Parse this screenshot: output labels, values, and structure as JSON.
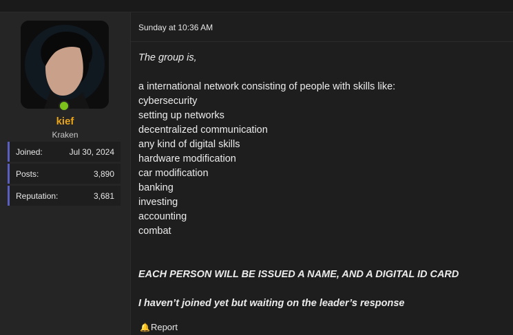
{
  "user": {
    "name": "kief",
    "title": "Kraken",
    "online": true,
    "stats": [
      {
        "label": "Joined:",
        "value": "Jul 30, 2024"
      },
      {
        "label": "Posts:",
        "value": "3,890"
      },
      {
        "label": "Reputation:",
        "value": "3,681"
      }
    ]
  },
  "post": {
    "timestamp": "Sunday at 10:36 AM",
    "intro": "The group is,",
    "lead": "a international network consisting of people with skills like:",
    "skills": [
      "cybersecurity",
      "setting up networks",
      "decentralized communication",
      "any kind of digital skills",
      "hardware modification",
      "car modification",
      "banking",
      "investing",
      "accounting",
      "combat"
    ],
    "headline": "EACH PERSON WILL BE ISSUED A NAME, AND A DIGITAL ID CARD",
    "note": "I haven’t joined yet but waiting on the leader’s response",
    "report_label": "Report"
  },
  "colors": {
    "username": "#e8a317",
    "online": "#7cc21a",
    "stat_accent": "#5a5fbf",
    "background": "#1e1e1e"
  },
  "icons": {
    "report": "bell-icon"
  }
}
